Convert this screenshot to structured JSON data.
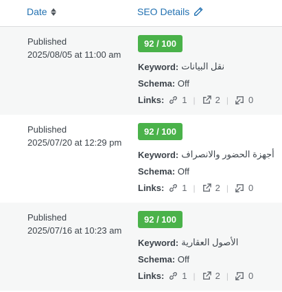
{
  "header": {
    "date_label": "Date",
    "seo_label": "SEO Details"
  },
  "rows": [
    {
      "status": "Published",
      "datetime": "2025/08/05 at 11:00 am",
      "score": "92 / 100",
      "keyword_label": "Keyword:",
      "keyword": "نقل البيانات",
      "schema_label": "Schema:",
      "schema": "Off",
      "links_label": "Links:",
      "internal": "1",
      "external": "2",
      "incoming": "0"
    },
    {
      "status": "Published",
      "datetime": "2025/07/20 at 12:29 pm",
      "score": "92 / 100",
      "keyword_label": "Keyword:",
      "keyword": "أجهزة الحضور والانصراف",
      "schema_label": "Schema:",
      "schema": "Off",
      "links_label": "Links:",
      "internal": "1",
      "external": "2",
      "incoming": "0"
    },
    {
      "status": "Published",
      "datetime": "2025/07/16 at 10:23 am",
      "score": "92 / 100",
      "keyword_label": "Keyword:",
      "keyword": "الأصول العقارية",
      "schema_label": "Schema:",
      "schema": "Off",
      "links_label": "Links:",
      "internal": "1",
      "external": "2",
      "incoming": "0"
    }
  ],
  "colors": {
    "link": "#2271b1",
    "score_bg": "#4ab24a",
    "row_alt": "#f6f7f7"
  },
  "icons": [
    "sort-icon",
    "pencil-icon",
    "link-icon",
    "external-link-icon",
    "incoming-link-icon"
  ]
}
